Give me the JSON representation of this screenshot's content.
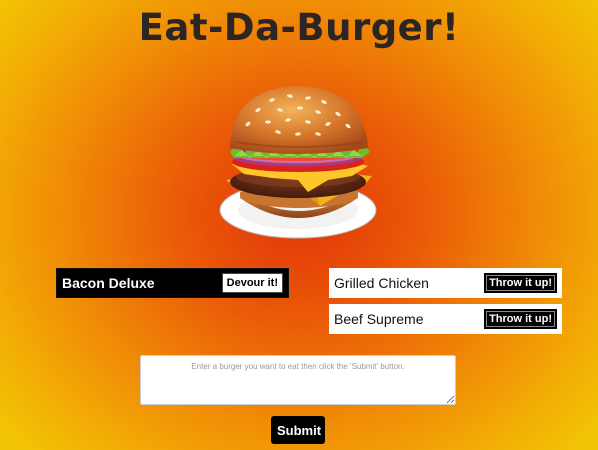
{
  "header": {
    "title": "Eat-Da-Burger!"
  },
  "hero": {
    "image": "burger-image"
  },
  "devoured": {
    "items": [
      {
        "name": "Bacon Deluxe",
        "button_label": "Devour it!"
      }
    ]
  },
  "eaten": {
    "items": [
      {
        "name": "Grilled Chicken",
        "button_label": "Throw it up!"
      },
      {
        "name": "Beef Supreme",
        "button_label": "Throw it up!"
      }
    ]
  },
  "form": {
    "placeholder": "Enter a burger you want to eat then click the 'Submit' button.",
    "value": "",
    "submit_label": "Submit"
  },
  "colors": {
    "background_center": "#e2350a",
    "background_edge": "#f2c204",
    "title": "#2b2523",
    "dark_row": "#000000",
    "light_row": "#ffffff"
  }
}
